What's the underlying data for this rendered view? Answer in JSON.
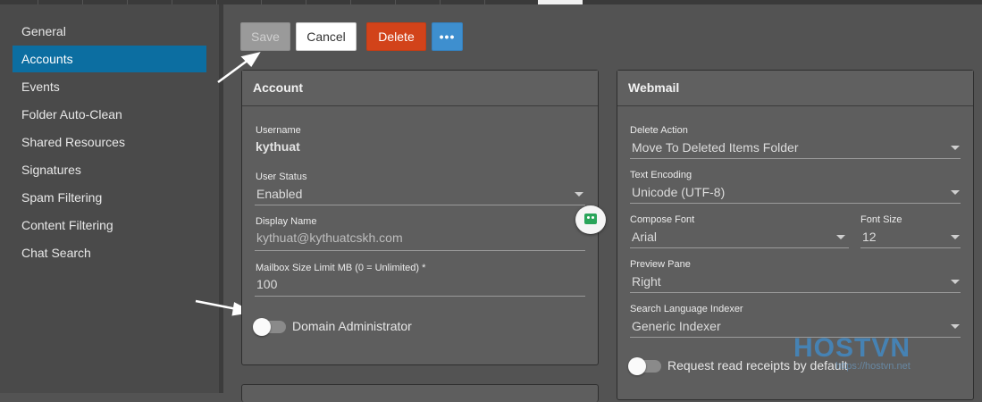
{
  "sidebar": {
    "items": [
      {
        "label": "General",
        "active": false
      },
      {
        "label": "Accounts",
        "active": true
      },
      {
        "label": "Events",
        "active": false
      },
      {
        "label": "Folder Auto-Clean",
        "active": false
      },
      {
        "label": "Shared Resources",
        "active": false
      },
      {
        "label": "Signatures",
        "active": false
      },
      {
        "label": "Spam Filtering",
        "active": false
      },
      {
        "label": "Content Filtering",
        "active": false
      },
      {
        "label": "Chat Search",
        "active": false
      }
    ]
  },
  "toolbar": {
    "save_label": "Save",
    "cancel_label": "Cancel",
    "delete_label": "Delete",
    "more_label": "•••"
  },
  "account": {
    "title": "Account",
    "username_label": "Username",
    "username_value": "kythuat",
    "user_status_label": "User Status",
    "user_status_value": "Enabled",
    "display_name_label": "Display Name",
    "display_name_value": "kythuat@kythuatcskh.com",
    "mailbox_label": "Mailbox Size Limit MB (0 = Unlimited) *",
    "mailbox_value": "100",
    "domain_admin_label": "Domain Administrator",
    "domain_admin_on": false
  },
  "webmail": {
    "title": "Webmail",
    "delete_action_label": "Delete Action",
    "delete_action_value": "Move To Deleted Items Folder",
    "text_encoding_label": "Text Encoding",
    "text_encoding_value": "Unicode (UTF-8)",
    "compose_font_label": "Compose Font",
    "compose_font_value": "Arial",
    "font_size_label": "Font Size",
    "font_size_value": "12",
    "preview_pane_label": "Preview Pane",
    "preview_pane_value": "Right",
    "search_indexer_label": "Search Language Indexer",
    "search_indexer_value": "Generic Indexer",
    "read_receipts_label": "Request read receipts by default",
    "read_receipts_on": false
  },
  "watermark": {
    "brand": "HOSTVN",
    "url": "https://hostvn.net"
  },
  "colors": {
    "accent": "#0c6ea1",
    "delete": "#d2431a",
    "more": "#3e8fcf"
  }
}
